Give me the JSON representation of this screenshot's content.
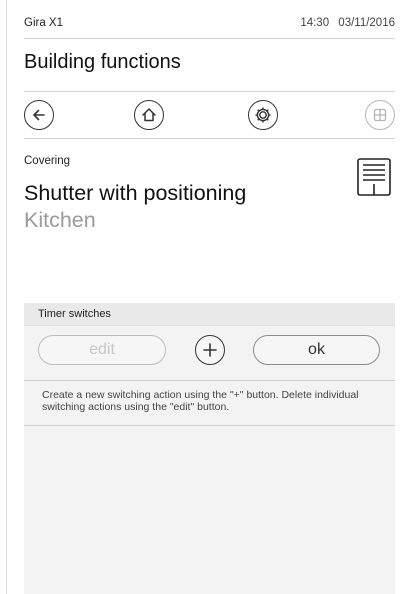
{
  "status": {
    "device": "Gira X1",
    "time": "14:30",
    "date": "03/11/2016"
  },
  "page": {
    "title": "Building functions"
  },
  "nav": {
    "back_icon": "arrow-left-icon",
    "home_icon": "home-icon",
    "settings_icon": "gear-icon",
    "grid_icon": "grid-icon"
  },
  "function": {
    "category": "Covering",
    "name": "Shutter with positioning",
    "room": "Kitchen",
    "icon": "shutter-icon"
  },
  "timer": {
    "header": "Timer switches",
    "edit_label": "edit",
    "add_icon": "plus-icon",
    "ok_label": "ok",
    "hint": "Create a new switching action using the \"+\" button. Delete individual switching actions using the \"edit\" button."
  },
  "colors": {
    "text": "#111111",
    "muted": "#9a9a9a",
    "panel": "#f3f3f3",
    "divider": "#d4d4d4"
  }
}
